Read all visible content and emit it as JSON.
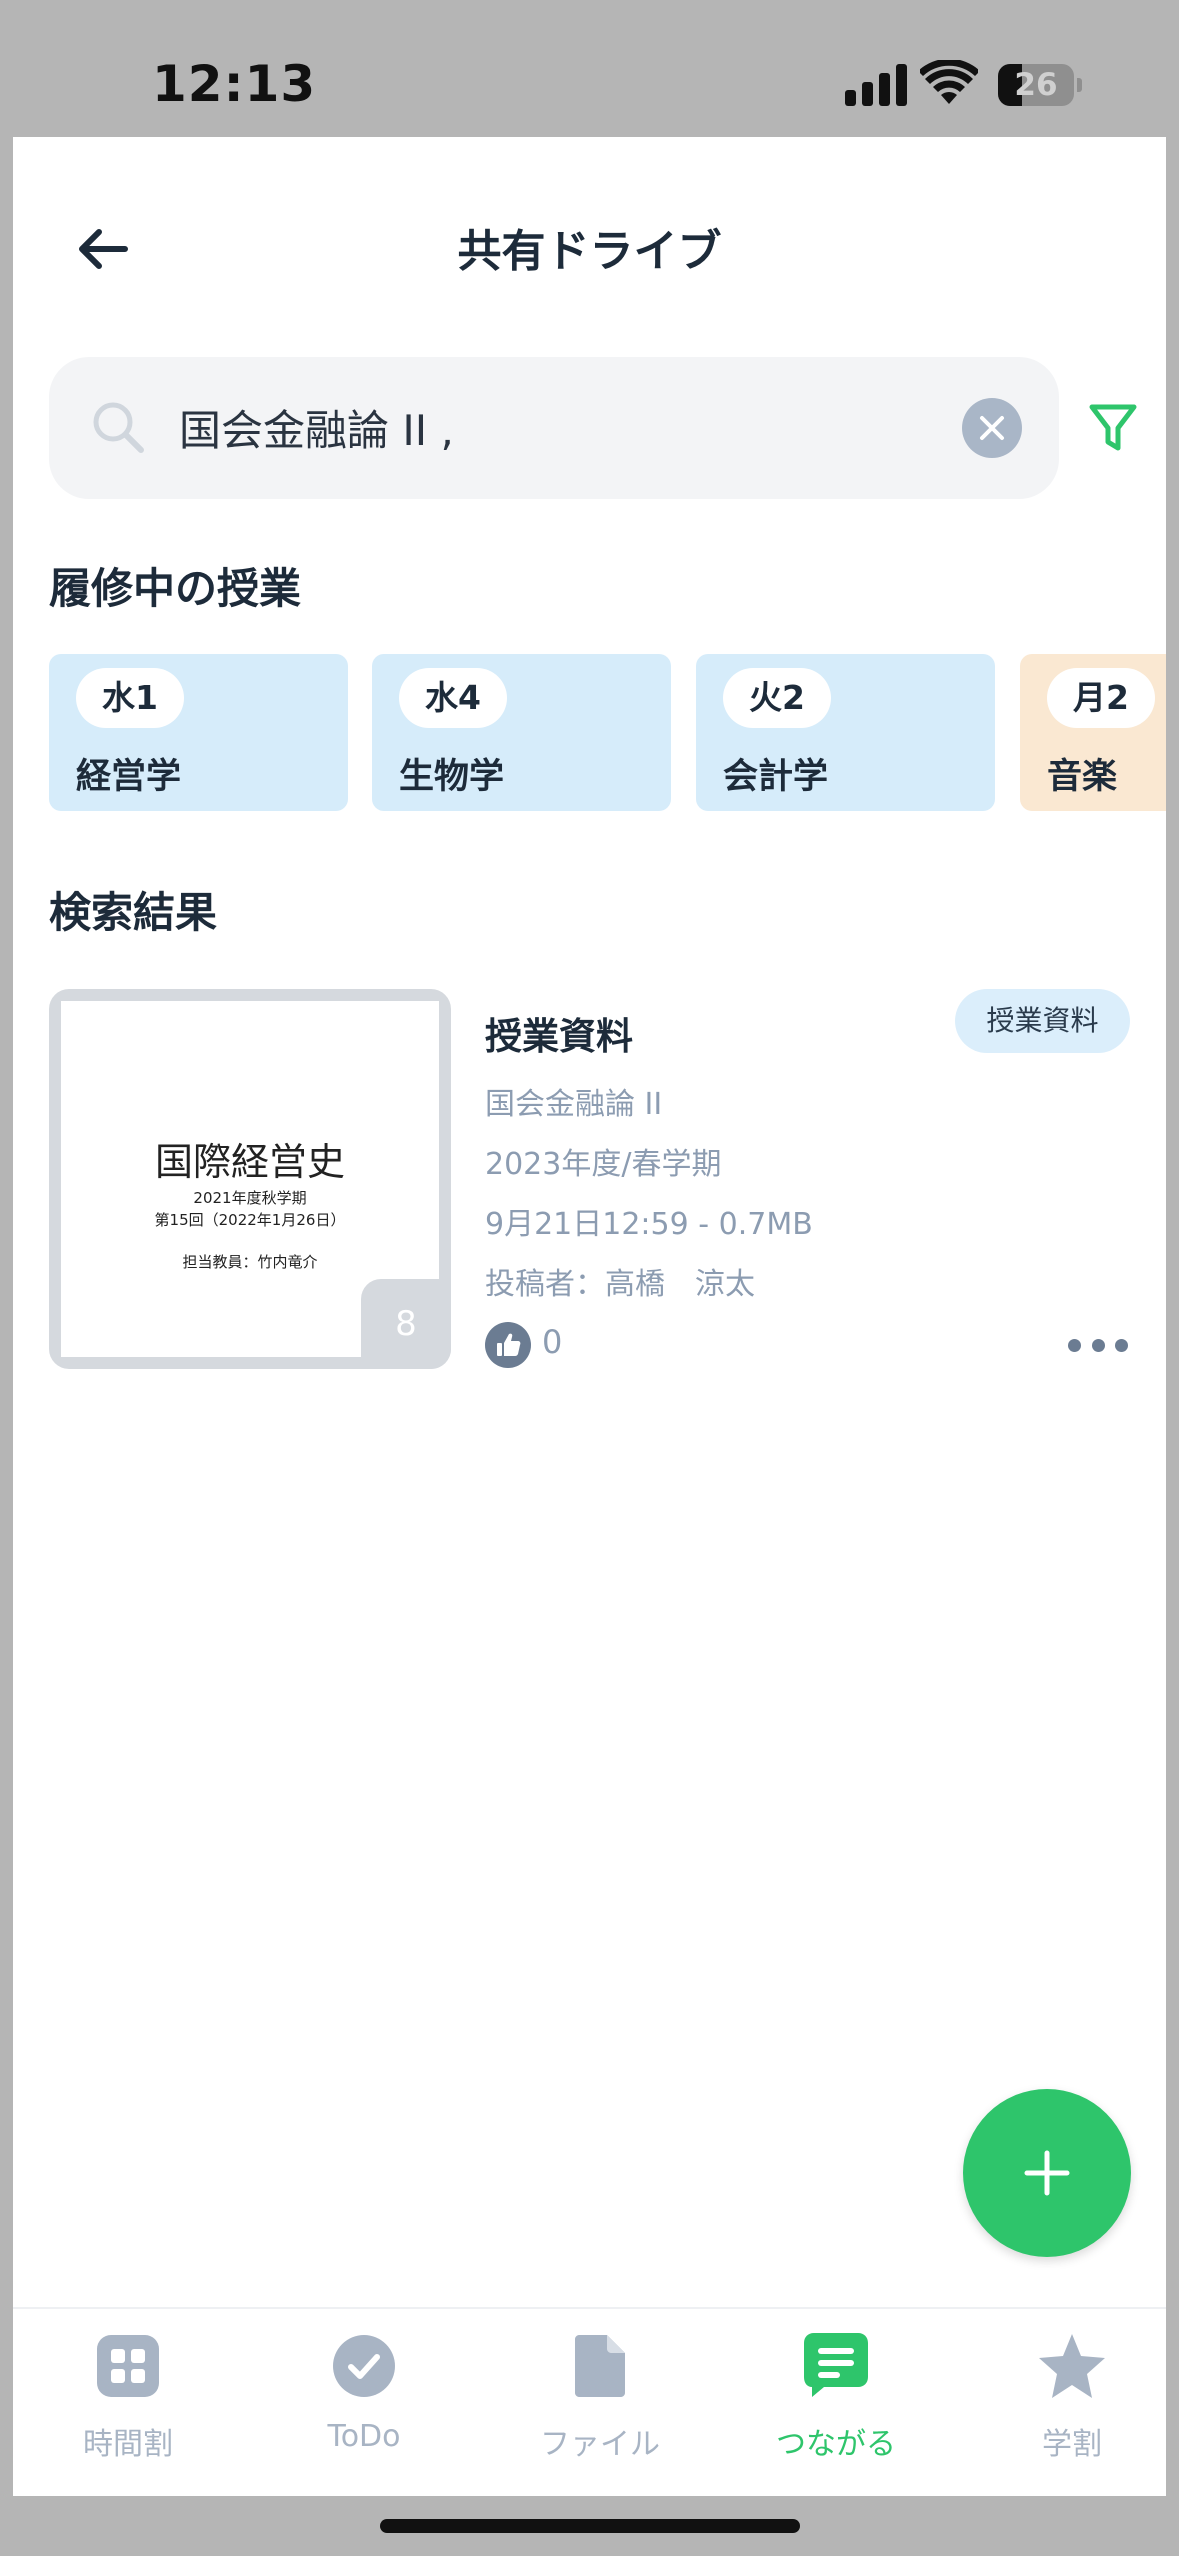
{
  "status_bar": {
    "time": "12:13",
    "battery": "26"
  },
  "header": {
    "title": "共有ドライブ"
  },
  "search": {
    "value": "国会金融論 II ,"
  },
  "courses_section": {
    "title": "履修中の授業",
    "items": [
      {
        "period": "水1",
        "name": "経営学",
        "color": "#d6ecfa"
      },
      {
        "period": "水4",
        "name": "生物学",
        "color": "#d6ecfa"
      },
      {
        "period": "火2",
        "name": "会計学",
        "color": "#d6ecfa"
      },
      {
        "period": "月2",
        "name": "音楽",
        "color": "#fae8d2"
      }
    ]
  },
  "results_section": {
    "title": "検索結果",
    "items": [
      {
        "thumbnail": {
          "title": "国際経営史",
          "line1": "2021年度秋学期",
          "line2": "第15回（2022年1月26日）",
          "line3": "担当教員：竹内竜介",
          "page_count": "8"
        },
        "title": "授業資料",
        "tag": "授業資料",
        "course": "国会金融論 II",
        "term": "2023年度/春学期",
        "date_size": "9月21日12:59 - 0.7MB",
        "author": "投稿者：高橋　涼太",
        "likes": "0"
      }
    ]
  },
  "tabbar": {
    "tabs": [
      {
        "label": "時間割",
        "icon": "timetable-icon"
      },
      {
        "label": "ToDo",
        "icon": "check-icon"
      },
      {
        "label": "ファイル",
        "icon": "file-icon"
      },
      {
        "label": "つながる",
        "icon": "chat-icon",
        "active": true
      },
      {
        "label": "学割",
        "icon": "star-icon"
      }
    ]
  },
  "colors": {
    "accent": "#2ec56b",
    "text": "#1d2b3a",
    "muted": "#8c9cb1"
  }
}
